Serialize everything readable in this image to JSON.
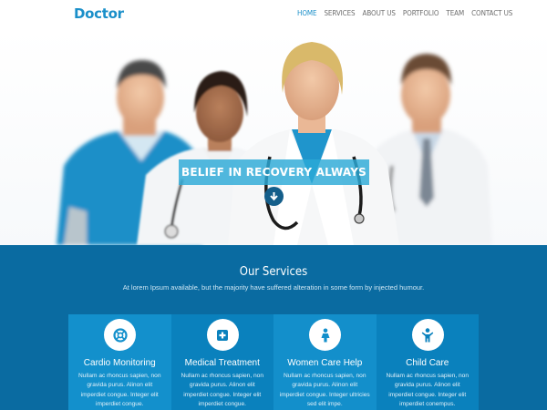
{
  "header": {
    "logo": "Doctor",
    "nav": [
      "HOME",
      "SERVICES",
      "ABOUT US",
      "PORTFOLIO",
      "TEAM",
      "CONTACT US"
    ],
    "active_index": 0
  },
  "hero": {
    "banner": "BELIEF IN RECOVERY ALWAYS",
    "arrow_icon": "arrow-down-circle-icon"
  },
  "services": {
    "title": "Our Services",
    "subtitle": "At lorem Ipsum available, but the majority have suffered alteration in some form by injected humour.",
    "items": [
      {
        "icon": "lifebuoy-icon",
        "title": "Cardio Monitoring",
        "text": "Nullam ac rhoncus sapien, non gravida purus. Alinon elit imperdiet congue. Integer elit imperdiet congue."
      },
      {
        "icon": "medical-plus-icon",
        "title": "Medical Treatment",
        "text": "Nullam ac rhoncus sapien, non gravida purus. Alinon elit imperdiet congue. Integer elit imperdiet congue."
      },
      {
        "icon": "woman-icon",
        "title": "Women Care Help",
        "text": "Nullam ac rhoncus sapien, non gravida purus. Alinon elit imperdiet congue. Integer ultricies sed elit impe."
      },
      {
        "icon": "child-icon",
        "title": "Child Care",
        "text": "Nullam ac rhoncus sapien, non gravida purus. Alinon elit imperdiet congue. Integer elit imperdiet conempus."
      }
    ]
  },
  "colors": {
    "brand": "#1a8fc9",
    "services_bg": "#0a6ba1",
    "banner_bg": "#2caad7"
  }
}
